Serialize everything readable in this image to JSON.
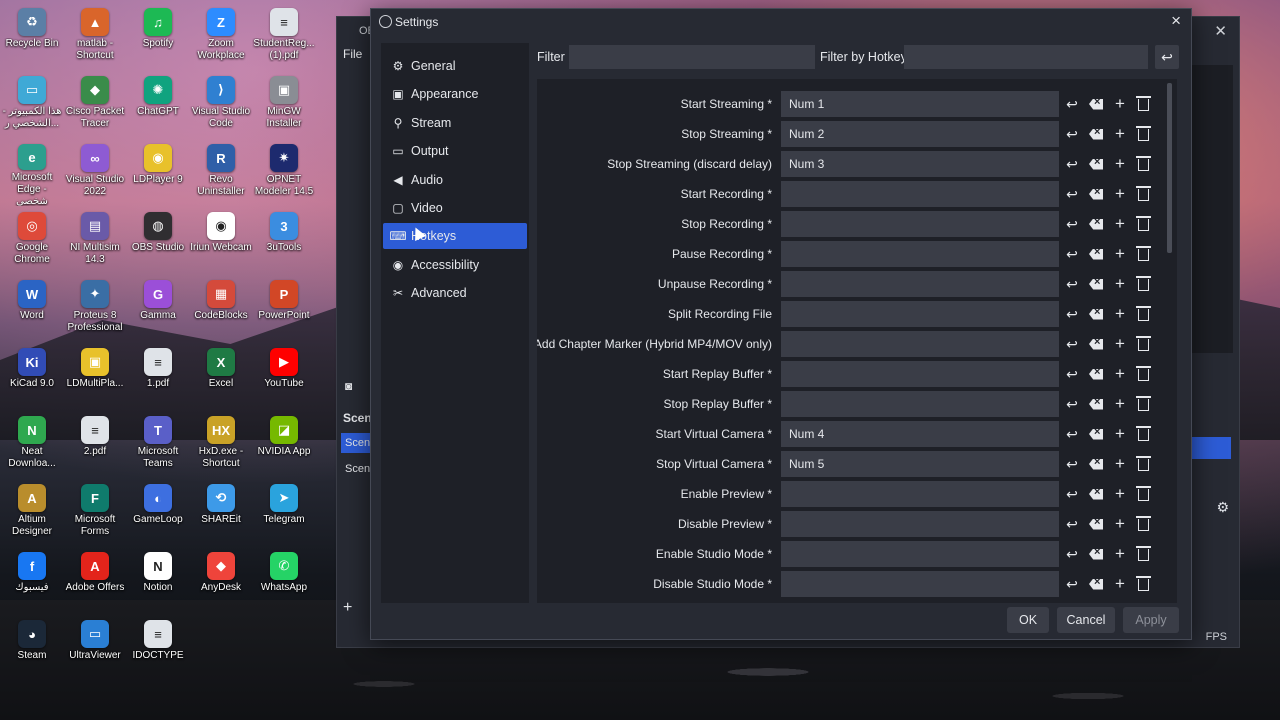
{
  "desktop": {
    "icons": [
      {
        "label": "Recycle Bin",
        "glyph": "♻",
        "color": "#5b7fa6"
      },
      {
        "label": "matlab - Shortcut",
        "glyph": "▲",
        "color": "#d9652b"
      },
      {
        "label": "Spotify",
        "glyph": "♫",
        "color": "#1db954"
      },
      {
        "label": "Zoom Workplace",
        "glyph": "Z",
        "color": "#2d8cff"
      },
      {
        "label": "StudentReg... (1).pdf",
        "glyph": "≡",
        "color": "#dfe3e8"
      },
      {
        "label": "هذا الكمبيوتر - الشخصي ر...",
        "glyph": "▭",
        "color": "#3fa9d6"
      },
      {
        "label": "Cisco Packet Tracer",
        "glyph": "◆",
        "color": "#3a8c4a"
      },
      {
        "label": "ChatGPT",
        "glyph": "✺",
        "color": "#10a37f"
      },
      {
        "label": "Visual Studio Code",
        "glyph": "⟩",
        "color": "#2f80d1"
      },
      {
        "label": "MinGW Installer",
        "glyph": "▣",
        "color": "#8a8d94"
      },
      {
        "label": "Microsoft Edge - شخصي",
        "glyph": "e",
        "color": "#2c9f8e"
      },
      {
        "label": "Visual Studio 2022",
        "glyph": "∞",
        "color": "#8e5bd3"
      },
      {
        "label": "LDPlayer 9",
        "glyph": "◉",
        "color": "#e8c12b"
      },
      {
        "label": "Revo Uninstaller",
        "glyph": "R",
        "color": "#2f5fa8"
      },
      {
        "label": "OPNET Modeler 14.5",
        "glyph": "✷",
        "color": "#1d2a6e"
      },
      {
        "label": "Google Chrome",
        "glyph": "◎",
        "color": "#de4a3a"
      },
      {
        "label": "NI Multisim 14.3",
        "glyph": "▤",
        "color": "#6a5aa8"
      },
      {
        "label": "OBS Studio",
        "glyph": "◍",
        "color": "#302e31"
      },
      {
        "label": "Iriun Webcam",
        "glyph": "◉",
        "color": "#ffffff"
      },
      {
        "label": "3uTools",
        "glyph": "3",
        "color": "#3b8de0"
      },
      {
        "label": "Word",
        "glyph": "W",
        "color": "#2b64c4"
      },
      {
        "label": "Proteus 8 Professional",
        "glyph": "✦",
        "color": "#3a6ea5"
      },
      {
        "label": "Gamma",
        "glyph": "G",
        "color": "#9b4fd8"
      },
      {
        "label": "CodeBlocks",
        "glyph": "▦",
        "color": "#d44a3b"
      },
      {
        "label": "PowerPoint",
        "glyph": "P",
        "color": "#d24726"
      },
      {
        "label": "KiCad 9.0",
        "glyph": "Ki",
        "color": "#314cb6"
      },
      {
        "label": "LDMultiPla...",
        "glyph": "▣",
        "color": "#e8c12b"
      },
      {
        "label": "1.pdf",
        "glyph": "≡",
        "color": "#dfe3e8"
      },
      {
        "label": "Excel",
        "glyph": "X",
        "color": "#1f7a44"
      },
      {
        "label": "YouTube",
        "glyph": "▶",
        "color": "#ff0000"
      },
      {
        "label": "Neat Downloa...",
        "glyph": "N",
        "color": "#2fa84f"
      },
      {
        "label": "2.pdf",
        "glyph": "≡",
        "color": "#dfe3e8"
      },
      {
        "label": "Microsoft Teams",
        "glyph": "T",
        "color": "#5a5fc8"
      },
      {
        "label": "HxD.exe - Shortcut",
        "glyph": "HX",
        "color": "#c9a227"
      },
      {
        "label": "NVIDIA App",
        "glyph": "◪",
        "color": "#76b900"
      },
      {
        "label": "Altium Designer",
        "glyph": "A",
        "color": "#b98d2c"
      },
      {
        "label": "Microsoft Forms",
        "glyph": "F",
        "color": "#0f7b6c"
      },
      {
        "label": "GameLoop",
        "glyph": "◐",
        "color": "#3d6fe0"
      },
      {
        "label": "SHAREit",
        "glyph": "⟲",
        "color": "#3d9ae8"
      },
      {
        "label": "Telegram",
        "glyph": "➤",
        "color": "#2aa3dd"
      },
      {
        "label": "فيسبوك",
        "glyph": "f",
        "color": "#1877f2"
      },
      {
        "label": "Adobe Offers",
        "glyph": "A",
        "color": "#e3241b"
      },
      {
        "label": "Notion",
        "glyph": "N",
        "color": "#ffffff"
      },
      {
        "label": "AnyDesk",
        "glyph": "◆",
        "color": "#ef443b"
      },
      {
        "label": "WhatsApp",
        "glyph": "✆",
        "color": "#25d366"
      },
      {
        "label": "Steam",
        "glyph": "◕",
        "color": "#1b2838"
      },
      {
        "label": "UltraViewer",
        "glyph": "▭",
        "color": "#2a7fd4"
      },
      {
        "label": "IDOCTYPE",
        "glyph": "≡",
        "color": "#dfe3e8"
      }
    ]
  },
  "obs_main": {
    "title": "OB",
    "file_menu": "File",
    "scenes_header": "Scene",
    "scene_items": [
      "Scene",
      "Scene"
    ],
    "fps": "FPS",
    "add": "+"
  },
  "settings": {
    "title": "Settings",
    "close": "×",
    "nav": [
      {
        "label": "General",
        "icon": "gear-icon",
        "glyph": "⚙"
      },
      {
        "label": "Appearance",
        "icon": "palette-icon",
        "glyph": "▣"
      },
      {
        "label": "Stream",
        "icon": "antenna-icon",
        "glyph": "⚲"
      },
      {
        "label": "Output",
        "icon": "monitor-icon",
        "glyph": "▭"
      },
      {
        "label": "Audio",
        "icon": "speaker-icon",
        "glyph": "◀"
      },
      {
        "label": "Video",
        "icon": "screen-icon",
        "glyph": "▢"
      },
      {
        "label": "Hotkeys",
        "icon": "keyboard-icon",
        "glyph": "⌨"
      },
      {
        "label": "Accessibility",
        "icon": "accessibility-icon",
        "glyph": "◉"
      },
      {
        "label": "Advanced",
        "icon": "wrench-icon",
        "glyph": "✂"
      }
    ],
    "active_nav": "Hotkeys",
    "filter_label": "Filter",
    "filter_value": "",
    "hotkey_filter_label": "Filter by Hotkey",
    "hotkey_filter_value": "",
    "hotkeys": [
      {
        "label": "Start Streaming *",
        "value": "Num 1"
      },
      {
        "label": "Stop Streaming *",
        "value": "Num 2"
      },
      {
        "label": "Stop Streaming (discard delay)",
        "value": "Num 3"
      },
      {
        "label": "Start Recording *",
        "value": ""
      },
      {
        "label": "Stop Recording *",
        "value": ""
      },
      {
        "label": "Pause Recording *",
        "value": ""
      },
      {
        "label": "Unpause Recording *",
        "value": ""
      },
      {
        "label": "Split Recording File",
        "value": ""
      },
      {
        "label": "Add Chapter Marker (Hybrid MP4/MOV only)",
        "value": ""
      },
      {
        "label": "Start Replay Buffer *",
        "value": ""
      },
      {
        "label": "Stop Replay Buffer *",
        "value": ""
      },
      {
        "label": "Start Virtual Camera *",
        "value": "Num 4"
      },
      {
        "label": "Stop Virtual Camera *",
        "value": "Num 5"
      },
      {
        "label": "Enable Preview *",
        "value": ""
      },
      {
        "label": "Disable Preview *",
        "value": ""
      },
      {
        "label": "Enable Studio Mode *",
        "value": ""
      },
      {
        "label": "Disable Studio Mode *",
        "value": ""
      }
    ],
    "buttons": {
      "ok": "OK",
      "cancel": "Cancel",
      "apply": "Apply"
    },
    "accent_color": "#2d5cd6"
  }
}
